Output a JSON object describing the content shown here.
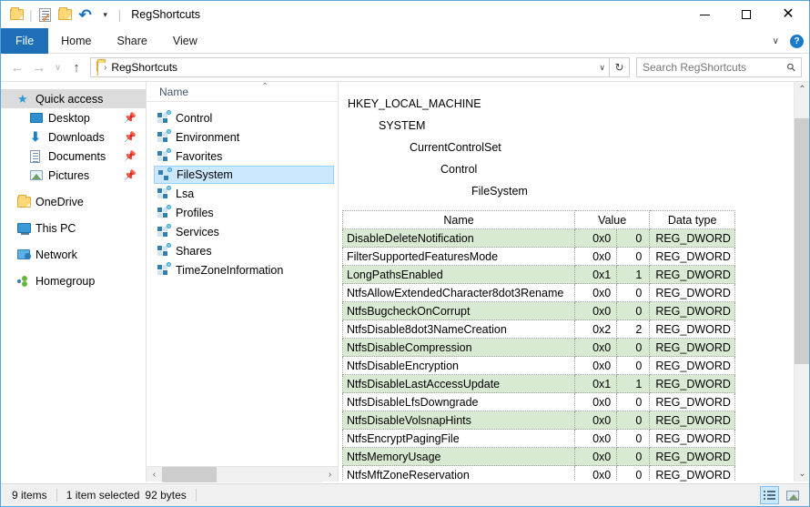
{
  "window": {
    "title": "RegShortcuts",
    "minimize_label": "Minimize",
    "maximize_label": "Maximize",
    "close_label": "Close"
  },
  "quick_access_toolbar": {
    "items": [
      {
        "name": "new-folder-icon",
        "tooltip": "New folder"
      },
      {
        "name": "properties-icon",
        "tooltip": "Properties"
      },
      {
        "name": "folder-icon",
        "tooltip": "Folder"
      },
      {
        "name": "undo-icon",
        "tooltip": "Undo"
      },
      {
        "name": "customize-caret-icon",
        "tooltip": "Customize Quick Access Toolbar"
      }
    ]
  },
  "ribbon": {
    "tabs": [
      {
        "label": "File",
        "active": true
      },
      {
        "label": "Home",
        "active": false
      },
      {
        "label": "Share",
        "active": false
      },
      {
        "label": "View",
        "active": false
      }
    ],
    "expand_caret": "∨",
    "help_label": "?"
  },
  "addressbar": {
    "back_label": "←",
    "forward_label": "→",
    "recent_label": "∨",
    "up_label": "↑",
    "separator": "›",
    "crumb": "RegShortcuts",
    "dropdown": "∨",
    "refresh": "↻"
  },
  "search": {
    "placeholder": "Search RegShortcuts",
    "icon": "search-icon"
  },
  "sidebar": {
    "items": [
      {
        "label": "Quick access",
        "icon": "star-icon",
        "selected": true,
        "indent": false,
        "pinned": false
      },
      {
        "label": "Desktop",
        "icon": "desktop-icon",
        "selected": false,
        "indent": true,
        "pinned": true
      },
      {
        "label": "Downloads",
        "icon": "download-icon",
        "selected": false,
        "indent": true,
        "pinned": true
      },
      {
        "label": "Documents",
        "icon": "document-icon",
        "selected": false,
        "indent": true,
        "pinned": true
      },
      {
        "label": "Pictures",
        "icon": "picture-icon",
        "selected": false,
        "indent": true,
        "pinned": true
      },
      {
        "label": "OneDrive",
        "icon": "folder-icon",
        "selected": false,
        "indent": false,
        "pinned": false
      },
      {
        "label": "This PC",
        "icon": "computer-icon",
        "selected": false,
        "indent": false,
        "pinned": false
      },
      {
        "label": "Network",
        "icon": "network-icon",
        "selected": false,
        "indent": false,
        "pinned": false
      },
      {
        "label": "Homegroup",
        "icon": "homegroup-icon",
        "selected": false,
        "indent": false,
        "pinned": false
      }
    ],
    "pin_glyph": "📌"
  },
  "filelist": {
    "column_header": "Name",
    "sort_arrow": "⌃",
    "items": [
      {
        "label": "Control",
        "selected": false
      },
      {
        "label": "Environment",
        "selected": false
      },
      {
        "label": "Favorites",
        "selected": false
      },
      {
        "label": "FileSystem",
        "selected": true
      },
      {
        "label": "Lsa",
        "selected": false
      },
      {
        "label": "Profiles",
        "selected": false
      },
      {
        "label": "Services",
        "selected": false
      },
      {
        "label": "Shares",
        "selected": false
      },
      {
        "label": "TimeZoneInformation",
        "selected": false
      }
    ],
    "hscroll_left": "‹",
    "hscroll_right": "›"
  },
  "preview": {
    "registry_path": [
      "HKEY_LOCAL_MACHINE",
      "SYSTEM",
      "CurrentControlSet",
      "Control",
      "FileSystem"
    ],
    "watermark": "",
    "table": {
      "headers": [
        "Name",
        "Value",
        "Data type"
      ],
      "rows": [
        {
          "name": "DisableDeleteNotification",
          "hex": "0x0",
          "dec": "0",
          "type": "REG_DWORD"
        },
        {
          "name": "FilterSupportedFeaturesMode",
          "hex": "0x0",
          "dec": "0",
          "type": "REG_DWORD"
        },
        {
          "name": "LongPathsEnabled",
          "hex": "0x1",
          "dec": "1",
          "type": "REG_DWORD"
        },
        {
          "name": "NtfsAllowExtendedCharacter8dot3Rename",
          "hex": "0x0",
          "dec": "0",
          "type": "REG_DWORD"
        },
        {
          "name": "NtfsBugcheckOnCorrupt",
          "hex": "0x0",
          "dec": "0",
          "type": "REG_DWORD"
        },
        {
          "name": "NtfsDisable8dot3NameCreation",
          "hex": "0x2",
          "dec": "2",
          "type": "REG_DWORD"
        },
        {
          "name": "NtfsDisableCompression",
          "hex": "0x0",
          "dec": "0",
          "type": "REG_DWORD"
        },
        {
          "name": "NtfsDisableEncryption",
          "hex": "0x0",
          "dec": "0",
          "type": "REG_DWORD"
        },
        {
          "name": "NtfsDisableLastAccessUpdate",
          "hex": "0x1",
          "dec": "1",
          "type": "REG_DWORD"
        },
        {
          "name": "NtfsDisableLfsDowngrade",
          "hex": "0x0",
          "dec": "0",
          "type": "REG_DWORD"
        },
        {
          "name": "NtfsDisableVolsnapHints",
          "hex": "0x0",
          "dec": "0",
          "type": "REG_DWORD"
        },
        {
          "name": "NtfsEncryptPagingFile",
          "hex": "0x0",
          "dec": "0",
          "type": "REG_DWORD"
        },
        {
          "name": "NtfsMemoryUsage",
          "hex": "0x0",
          "dec": "0",
          "type": "REG_DWORD"
        },
        {
          "name": "NtfsMftZoneReservation",
          "hex": "0x0",
          "dec": "0",
          "type": "REG_DWORD"
        }
      ]
    },
    "vscroll_up": "⌃",
    "vscroll_down": "⌄"
  },
  "statusbar": {
    "item_count": "9 items",
    "selection": "1 item selected",
    "size": "92 bytes",
    "view_details": "details-view-icon",
    "view_thumbnails": "thumbnail-view-icon"
  },
  "colors": {
    "accent": "#1e6fb8",
    "selection": "#cce8ff",
    "row_alt": "#d9ead3",
    "window_border": "#5aa5d4"
  }
}
